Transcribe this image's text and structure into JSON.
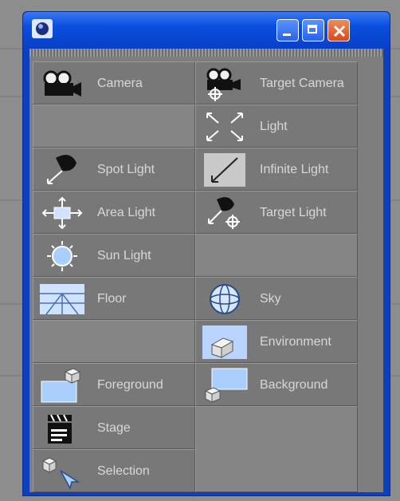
{
  "window": {
    "controls": [
      "minimize",
      "maximize",
      "close"
    ]
  },
  "items": {
    "camera": "Camera",
    "target_camera": "Target Camera",
    "light": "Light",
    "spot_light": "Spot Light",
    "infinite_light": "Infinite Light",
    "area_light": "Area Light",
    "target_light": "Target Light",
    "sun_light": "Sun Light",
    "floor": "Floor",
    "sky": "Sky",
    "environment": "Environment",
    "foreground": "Foreground",
    "background": "Background",
    "stage": "Stage",
    "selection": "Selection"
  },
  "colors": {
    "titlebar": "#0b4fe0",
    "panel": "#7e7e7e",
    "label": "#d8d8d8",
    "close_button": "#d84a1c"
  }
}
